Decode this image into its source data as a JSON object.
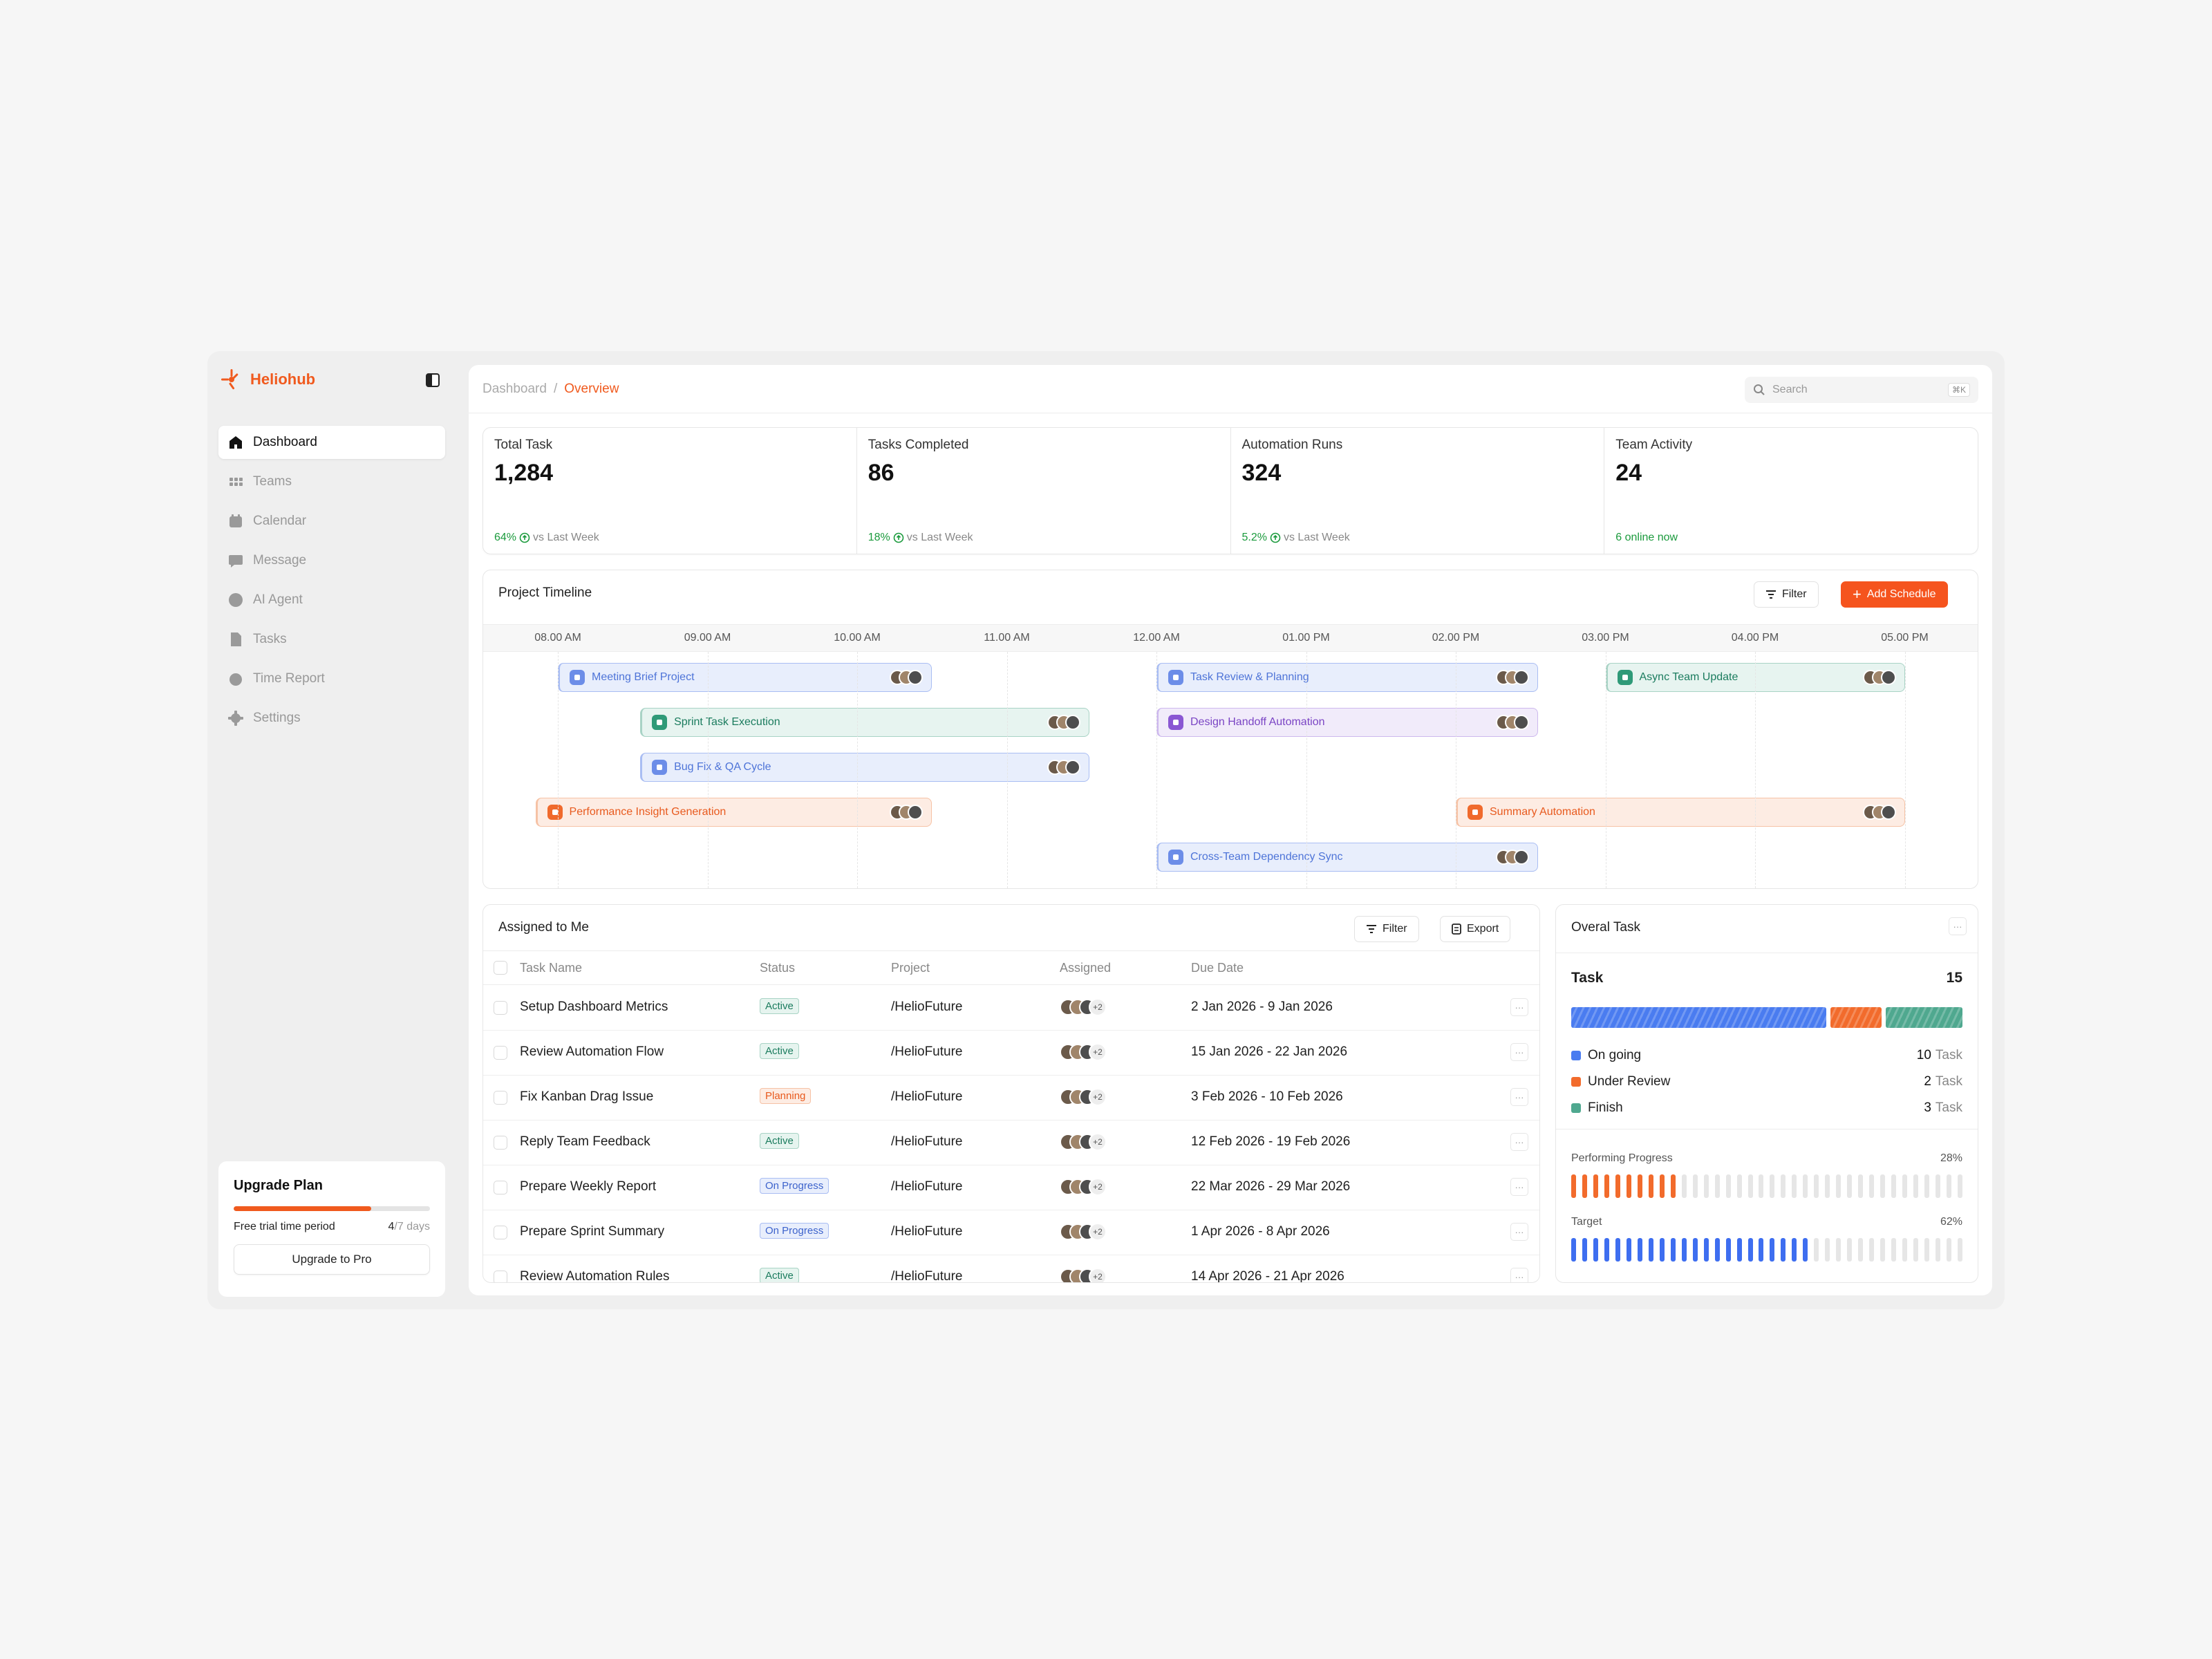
{
  "app": {
    "name": "Heliohub",
    "brand_color": "#f05a1e"
  },
  "sidebar": {
    "items": [
      {
        "label": "Dashboard",
        "icon": "home-icon",
        "active": true
      },
      {
        "label": "Teams",
        "icon": "grid-icon"
      },
      {
        "label": "Calendar",
        "icon": "calendar-icon"
      },
      {
        "label": "Message",
        "icon": "chat-icon"
      },
      {
        "label": "AI Agent",
        "icon": "ai-icon"
      },
      {
        "label": "Tasks",
        "icon": "document-icon"
      },
      {
        "label": "Time Report",
        "icon": "clock-icon"
      },
      {
        "label": "Settings",
        "icon": "gear-icon"
      }
    ],
    "upgrade": {
      "title": "Upgrade Plan",
      "period_label": "Free trial time period",
      "days_used": "4",
      "days_total": "/7 days",
      "progress": 0.7,
      "button": "Upgrade to Pro"
    }
  },
  "header": {
    "breadcrumb": [
      "Dashboard",
      "Overview"
    ],
    "search_placeholder": "Search",
    "search_shortcut": "⌘K"
  },
  "stats": [
    {
      "label": "Total Task",
      "value": "1,284",
      "delta": "64%",
      "note": "vs Last Week"
    },
    {
      "label": "Tasks Completed",
      "value": "86",
      "delta": "18%",
      "note": "vs Last Week"
    },
    {
      "label": "Automation Runs",
      "value": "324",
      "delta": "5.2%",
      "note": "vs Last Week"
    },
    {
      "label": "Team Activity",
      "value": "24",
      "delta": "6 online now",
      "note": ""
    }
  ],
  "timeline": {
    "title": "Project Timeline",
    "filter_label": "Filter",
    "add_label": "Add Schedule",
    "hours": [
      "08.00 AM",
      "09.00 AM",
      "10.00 AM",
      "11.00 AM",
      "12.00 AM",
      "01.00 PM",
      "02.00 PM",
      "03.00 PM",
      "04.00 PM",
      "05.00 PM"
    ],
    "events": [
      {
        "label": "Meeting Brief Project",
        "color": "blue",
        "start": 8.0,
        "end": 10.5,
        "row": 0
      },
      {
        "label": "Task Review & Planning",
        "color": "blue",
        "start": 12.0,
        "end": 14.55,
        "row": 0
      },
      {
        "label": "Async Team Update",
        "color": "teal",
        "start": 15.0,
        "end": 17.0,
        "row": 0
      },
      {
        "label": "Sprint Task Execution",
        "color": "teal",
        "start": 8.55,
        "end": 11.55,
        "row": 1
      },
      {
        "label": "Design Handoff Automation",
        "color": "purple",
        "start": 12.0,
        "end": 14.55,
        "row": 1
      },
      {
        "label": "Bug Fix & QA Cycle",
        "color": "blue",
        "start": 8.55,
        "end": 11.55,
        "row": 2
      },
      {
        "label": "Performance Insight Generation",
        "color": "orange",
        "start": 7.85,
        "end": 10.5,
        "row": 3
      },
      {
        "label": "Summary Automation",
        "color": "orange",
        "start": 14.0,
        "end": 17.0,
        "row": 3
      },
      {
        "label": "Cross-Team Dependency Sync",
        "color": "blue",
        "start": 12.0,
        "end": 14.55,
        "row": 4
      }
    ]
  },
  "assigned": {
    "title": "Assigned to Me",
    "filter_label": "Filter",
    "export_label": "Export",
    "columns": [
      "Task Name",
      "Status",
      "Project",
      "Assigned",
      "Due Date"
    ],
    "rows": [
      {
        "name": "Setup Dashboard Metrics",
        "status": "Active",
        "project": "/HelioFuture",
        "extra": "+2",
        "due": "2 Jan 2026 - 9 Jan 2026"
      },
      {
        "name": "Review Automation Flow",
        "status": "Active",
        "project": "/HelioFuture",
        "extra": "+2",
        "due": "15 Jan 2026 - 22 Jan 2026"
      },
      {
        "name": "Fix Kanban Drag Issue",
        "status": "Planning",
        "project": "/HelioFuture",
        "extra": "+2",
        "due": "3 Feb 2026 - 10 Feb 2026"
      },
      {
        "name": "Reply Team Feedback",
        "status": "Active",
        "project": "/HelioFuture",
        "extra": "+2",
        "due": "12 Feb 2026 - 19 Feb 2026"
      },
      {
        "name": "Prepare Weekly Report",
        "status": "On Progress",
        "project": "/HelioFuture",
        "extra": "+2",
        "due": "22 Mar 2026 - 29 Mar 2026"
      },
      {
        "name": "Prepare Sprint Summary",
        "status": "On Progress",
        "project": "/HelioFuture",
        "extra": "+2",
        "due": "1 Apr 2026 - 8 Apr 2026"
      },
      {
        "name": "Review Automation Rules",
        "status": "Active",
        "project": "/HelioFuture",
        "extra": "+2",
        "due": "14 Apr 2026 - 21 Apr 2026"
      }
    ]
  },
  "overall": {
    "title": "Overal Task",
    "task_label": "Task",
    "task_total": "15",
    "legend": [
      {
        "label": "On going",
        "count": "10",
        "unit": "Task",
        "color": "#4a7cf0"
      },
      {
        "label": "Under Review",
        "count": "2",
        "unit": "Task",
        "color": "#f26b2c"
      },
      {
        "label": "Finish",
        "count": "3",
        "unit": "Task",
        "color": "#4fa88f"
      }
    ],
    "performing": {
      "label": "Performing Progress",
      "pct": "28%",
      "value": 0.28,
      "color": "#f26b2c"
    },
    "target": {
      "label": "Target",
      "pct": "62%",
      "value": 0.62,
      "color": "#3e6ef0"
    }
  }
}
